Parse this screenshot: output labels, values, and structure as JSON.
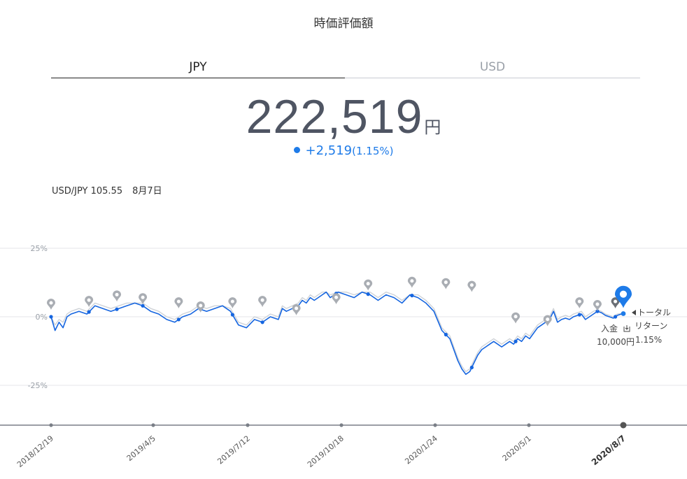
{
  "header": {
    "title": "時価評価額"
  },
  "tabs": [
    {
      "label": "JPY",
      "active": true
    },
    {
      "label": "USD",
      "active": false
    }
  ],
  "summary": {
    "value": "222,519",
    "unit": "円",
    "change": "+2,519",
    "change_pct": "(1.15%)",
    "accent_color": "#1e7be8"
  },
  "fx": {
    "label": "USD/JPY 105.55",
    "date": "8月7日"
  },
  "annotations": {
    "deposit_label": "入金",
    "deposit_amount": "10,000円",
    "return_label_1": "トータル",
    "return_label_2": "リターン",
    "return_value": "1.15%"
  },
  "chart_data": {
    "type": "line",
    "ylim": [
      -0.3,
      0.25
    ],
    "y_ticks": [
      "25%",
      "0%",
      "-25%"
    ],
    "y_tick_values": [
      0.25,
      0,
      -0.25
    ],
    "x_ticks": [
      "2018/12/19",
      "2019/4/5",
      "2019/7/12",
      "2019/10/18",
      "2020/1/24",
      "2020/5/1",
      "2020/8/7"
    ],
    "grid": true,
    "series": [
      {
        "color": "#1565e0",
        "x": [
          0,
          2,
          4,
          6,
          8,
          10,
          14,
          18,
          22,
          26,
          30,
          34,
          38,
          42,
          46,
          50,
          54,
          58,
          62,
          66,
          70,
          74,
          78,
          82,
          86,
          90,
          94,
          98,
          102,
          106,
          110,
          114,
          116,
          118,
          121,
          124,
          126,
          128,
          130,
          132,
          134,
          136,
          138,
          140,
          144,
          148,
          152,
          156,
          160,
          164,
          168,
          172,
          176,
          180,
          184,
          188,
          192,
          196,
          200,
          202,
          204,
          206,
          208,
          210,
          212,
          214,
          216,
          218,
          220,
          222,
          224,
          226,
          228,
          230,
          232,
          234,
          236,
          238,
          240,
          242,
          244,
          246,
          248,
          250,
          252,
          254,
          256,
          258,
          260,
          262,
          264,
          266,
          268,
          270,
          272,
          274,
          276,
          278,
          280,
          282,
          284,
          286,
          287
        ],
        "y": [
          0,
          -0.05,
          -0.02,
          -0.04,
          0.0,
          0.01,
          0.02,
          0.01,
          0.04,
          0.03,
          0.02,
          0.03,
          0.04,
          0.05,
          0.04,
          0.02,
          0.01,
          -0.01,
          -0.02,
          0.0,
          0.01,
          0.03,
          0.02,
          0.03,
          0.04,
          0.02,
          -0.03,
          -0.04,
          -0.01,
          -0.02,
          0.0,
          -0.01,
          0.03,
          0.02,
          0.03,
          0.04,
          0.06,
          0.05,
          0.07,
          0.06,
          0.07,
          0.08,
          0.09,
          0.07,
          0.09,
          0.08,
          0.07,
          0.09,
          0.08,
          0.06,
          0.08,
          0.07,
          0.05,
          0.08,
          0.07,
          0.05,
          0.02,
          -0.05,
          -0.08,
          -0.12,
          -0.16,
          -0.19,
          -0.21,
          -0.2,
          -0.17,
          -0.14,
          -0.12,
          -0.11,
          -0.1,
          -0.09,
          -0.1,
          -0.11,
          -0.1,
          -0.09,
          -0.1,
          -0.08,
          -0.09,
          -0.07,
          -0.08,
          -0.06,
          -0.04,
          -0.03,
          -0.02,
          -0.01,
          0.02,
          -0.02,
          -0.01,
          -0.005,
          -0.01,
          0.0,
          0.005,
          0.01,
          -0.01,
          0.0,
          0.01,
          0.02,
          0.015,
          0.005,
          0.0,
          -0.005,
          0.005,
          0.01,
          0.0115
        ]
      },
      {
        "color": "#cfd3d8",
        "x": [
          0,
          2,
          4,
          6,
          8,
          10,
          14,
          18,
          22,
          26,
          30,
          34,
          38,
          42,
          46,
          50,
          54,
          58,
          62,
          66,
          70,
          74,
          78,
          82,
          86,
          90,
          94,
          98,
          102,
          106,
          110,
          114,
          116,
          118,
          121,
          124,
          126,
          128,
          130,
          132,
          134,
          136,
          138,
          140,
          144,
          148,
          152,
          156,
          160,
          164,
          168,
          172,
          176,
          180,
          184,
          188,
          192,
          196,
          200,
          202,
          204,
          206,
          208,
          210,
          212,
          214,
          216,
          218,
          220,
          222,
          224,
          226,
          228,
          230,
          232,
          234,
          236,
          238,
          240,
          242,
          244,
          246,
          248,
          250,
          252,
          254,
          256,
          258,
          260,
          262,
          264,
          266,
          268,
          270,
          272,
          274,
          276,
          278,
          280,
          282,
          284,
          286,
          287
        ],
        "y": [
          0,
          -0.03,
          -0.01,
          -0.02,
          0.01,
          0.02,
          0.03,
          0.02,
          0.05,
          0.04,
          0.03,
          0.04,
          0.05,
          0.05,
          0.05,
          0.03,
          0.02,
          0.0,
          -0.01,
          0.01,
          0.02,
          0.04,
          0.03,
          0.04,
          0.04,
          0.03,
          -0.02,
          -0.03,
          0.0,
          -0.01,
          0.01,
          0.0,
          0.04,
          0.03,
          0.04,
          0.05,
          0.07,
          0.06,
          0.08,
          0.07,
          0.08,
          0.09,
          0.09,
          0.08,
          0.09,
          0.09,
          0.08,
          0.09,
          0.09,
          0.07,
          0.09,
          0.08,
          0.06,
          0.08,
          0.08,
          0.06,
          0.03,
          -0.04,
          -0.07,
          -0.11,
          -0.15,
          -0.18,
          -0.2,
          -0.19,
          -0.16,
          -0.13,
          -0.11,
          -0.1,
          -0.09,
          -0.08,
          -0.09,
          -0.1,
          -0.09,
          -0.08,
          -0.09,
          -0.07,
          -0.08,
          -0.06,
          -0.07,
          -0.05,
          -0.03,
          -0.02,
          -0.01,
          0.0,
          0.03,
          -0.01,
          0.0,
          0.005,
          0.0,
          0.01,
          0.015,
          0.02,
          0.0,
          0.01,
          0.02,
          0.025,
          0.02,
          0.01,
          0.005,
          0.0,
          0.01,
          0.012,
          0.0115
        ]
      }
    ],
    "markers_x": [
      0,
      19,
      33,
      46,
      64,
      75,
      91,
      106,
      123,
      143,
      159,
      181,
      198,
      211,
      233,
      249,
      265,
      274,
      283
    ],
    "markers_y": [
      0.0,
      0.01,
      0.03,
      0.02,
      0.005,
      -0.01,
      0.005,
      0.01,
      -0.02,
      0.02,
      0.07,
      0.08,
      0.075,
      0.065,
      -0.05,
      -0.06,
      0.005,
      -0.005,
      0.005
    ],
    "marker_color": "#a9adb3",
    "deposit_marker_x": 283,
    "current_marker_x": 287,
    "current_marker_color": "#1e7be8"
  }
}
